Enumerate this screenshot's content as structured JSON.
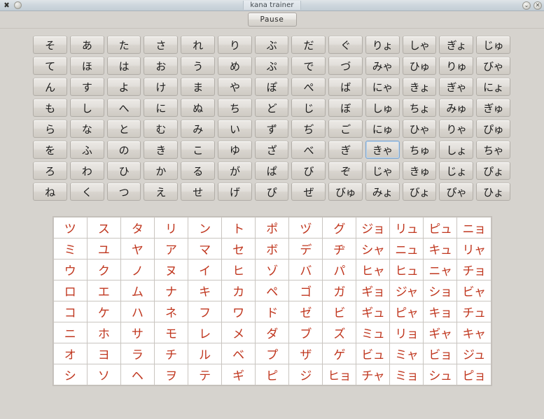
{
  "window": {
    "title": "kana trainer",
    "app_icon": "app-icon",
    "menu_orb_icon": "menu-orb-icon",
    "shade_button_label": "⌄",
    "close_button_label": "✕"
  },
  "toolbar": {
    "pause_label": "Pause"
  },
  "colors": {
    "window_background": "#d6d3ce",
    "titlebar_top": "#dfe5e9",
    "titlebar_bottom": "#c3ced6",
    "button_face": "#e2dfda",
    "button_border": "#b1ada7",
    "focus_border": "#7aa5d2",
    "katakana_text": "#c0371f",
    "katakana_cell_background": "#ffffff",
    "katakana_grid_line": "#c9c5c0",
    "hiragana_text": "#1b1b1b"
  },
  "hiragana_grid": {
    "columns": 13,
    "rows": 8,
    "focused_cell": "きゃ",
    "cells": [
      [
        "そ",
        "あ",
        "た",
        "さ",
        "れ",
        "り",
        "ぶ",
        "だ",
        "ぐ",
        "りょ",
        "しゃ",
        "ぎょ",
        "じゅ"
      ],
      [
        "て",
        "ほ",
        "は",
        "お",
        "う",
        "め",
        "ぷ",
        "で",
        "づ",
        "みゃ",
        "ひゅ",
        "りゅ",
        "びゃ"
      ],
      [
        "ん",
        "す",
        "よ",
        "け",
        "ま",
        "や",
        "ぽ",
        "ぺ",
        "ば",
        "にゃ",
        "きょ",
        "ぎゃ",
        "にょ"
      ],
      [
        "も",
        "し",
        "へ",
        "に",
        "ぬ",
        "ち",
        "ど",
        "じ",
        "ぼ",
        "しゅ",
        "ちょ",
        "みゅ",
        "ぎゅ"
      ],
      [
        "ら",
        "な",
        "と",
        "む",
        "み",
        "い",
        "ず",
        "ぢ",
        "ご",
        "にゅ",
        "ひゃ",
        "りゃ",
        "ぴゅ"
      ],
      [
        "を",
        "ふ",
        "の",
        "き",
        "こ",
        "ゆ",
        "ざ",
        "べ",
        "ぎ",
        "きゃ",
        "ちゅ",
        "しょ",
        "ちゃ"
      ],
      [
        "ろ",
        "わ",
        "ひ",
        "か",
        "る",
        "が",
        "ぱ",
        "び",
        "ぞ",
        "じゃ",
        "きゅ",
        "じょ",
        "ぴょ"
      ],
      [
        "ね",
        "く",
        "つ",
        "え",
        "せ",
        "げ",
        "ぴ",
        "ぜ",
        "びゅ",
        "みょ",
        "びょ",
        "ぴゃ",
        "ひょ"
      ]
    ]
  },
  "katakana_grid": {
    "columns": 13,
    "rows": 8,
    "cells": [
      [
        "ツ",
        "ス",
        "タ",
        "リ",
        "ン",
        "ト",
        "ポ",
        "ヅ",
        "グ",
        "ジョ",
        "リュ",
        "ピュ",
        "ニョ"
      ],
      [
        "ミ",
        "ユ",
        "ヤ",
        "ア",
        "マ",
        "セ",
        "ボ",
        "デ",
        "ヂ",
        "シャ",
        "ニュ",
        "キュ",
        "リャ"
      ],
      [
        "ウ",
        "ク",
        "ノ",
        "ヌ",
        "イ",
        "ヒ",
        "ゾ",
        "バ",
        "パ",
        "ヒャ",
        "ヒュ",
        "ニャ",
        "チョ"
      ],
      [
        "ロ",
        "エ",
        "ム",
        "ナ",
        "キ",
        "カ",
        "ペ",
        "ゴ",
        "ガ",
        "ギョ",
        "ジャ",
        "ショ",
        "ビャ"
      ],
      [
        "コ",
        "ケ",
        "ハ",
        "ネ",
        "フ",
        "ワ",
        "ド",
        "ゼ",
        "ビ",
        "ギュ",
        "ピャ",
        "キョ",
        "チュ"
      ],
      [
        "ニ",
        "ホ",
        "サ",
        "モ",
        "レ",
        "メ",
        "ダ",
        "ブ",
        "ズ",
        "ミュ",
        "リョ",
        "ギャ",
        "キャ"
      ],
      [
        "オ",
        "ヨ",
        "ラ",
        "チ",
        "ル",
        "ベ",
        "プ",
        "ザ",
        "ゲ",
        "ビュ",
        "ミャ",
        "ビョ",
        "ジュ"
      ],
      [
        "シ",
        "ソ",
        "ヘ",
        "ヲ",
        "テ",
        "ギ",
        "ピ",
        "ジ",
        "ヒョ",
        "チャ",
        "ミョ",
        "シュ",
        "ピョ"
      ]
    ]
  }
}
